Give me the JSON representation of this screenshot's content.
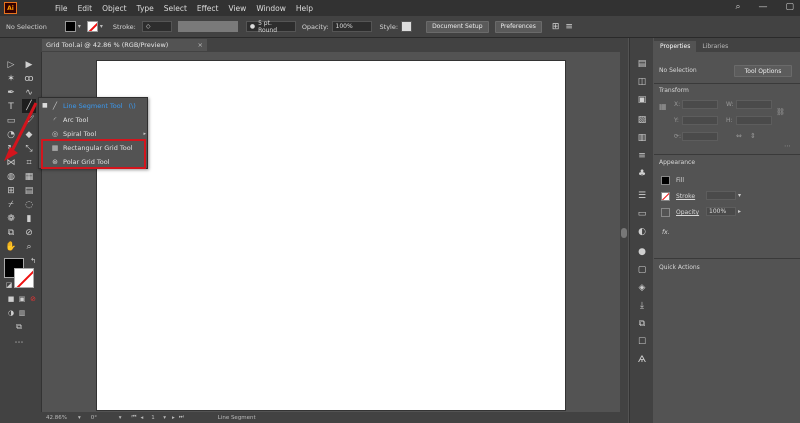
{
  "app": {
    "logo_text": "Ai"
  },
  "menu": [
    "File",
    "Edit",
    "Object",
    "Type",
    "Select",
    "Effect",
    "View",
    "Window",
    "Help"
  ],
  "menubar_right": {
    "search_icon": "search-icon",
    "minimize": "—",
    "maximize": "▢"
  },
  "control_bar": {
    "selection_label": "No Selection",
    "stroke_label": "Stroke:",
    "brush_label": "5 pt. Round",
    "opacity_label": "Opacity:",
    "opacity_value": "100%",
    "style_label": "Style:",
    "document_setup": "Document Setup",
    "preferences": "Preferences"
  },
  "document_tab": {
    "title": "Grid Tool.ai @ 42.86 % (RGB/Preview)",
    "close": "×"
  },
  "flyout": {
    "items": [
      {
        "label": "Line Segment Tool",
        "shortcut": "(\\)",
        "icon": "line-segment-icon"
      },
      {
        "label": "Arc Tool",
        "icon": "arc-icon"
      },
      {
        "label": "Spiral Tool",
        "icon": "spiral-icon"
      },
      {
        "label": "Rectangular Grid Tool",
        "icon": "rectangular-grid-icon"
      },
      {
        "label": "Polar Grid Tool",
        "icon": "polar-grid-icon"
      }
    ]
  },
  "status_bar": {
    "zoom": "42.86%",
    "rotation": "0°",
    "page": "1",
    "tool": "Line Segment"
  },
  "panel": {
    "tabs": [
      "Properties",
      "Libraries"
    ],
    "selection_label": "No Selection",
    "tool_options": "Tool Options",
    "transform_title": "Transform",
    "transform_fields": {
      "x": "X:",
      "y": "Y:",
      "w": "W:",
      "h": "H:",
      "rotate": "⟳:"
    },
    "appearance_title": "Appearance",
    "fill_label": "Fill",
    "stroke_label": "Stroke",
    "opacity_label": "Opacity",
    "opacity_value": "100%",
    "fx_label": "fx.",
    "quick_actions_title": "Quick Actions"
  },
  "colors": {
    "accent": "#3a9af2",
    "highlight": "#d3151d"
  }
}
